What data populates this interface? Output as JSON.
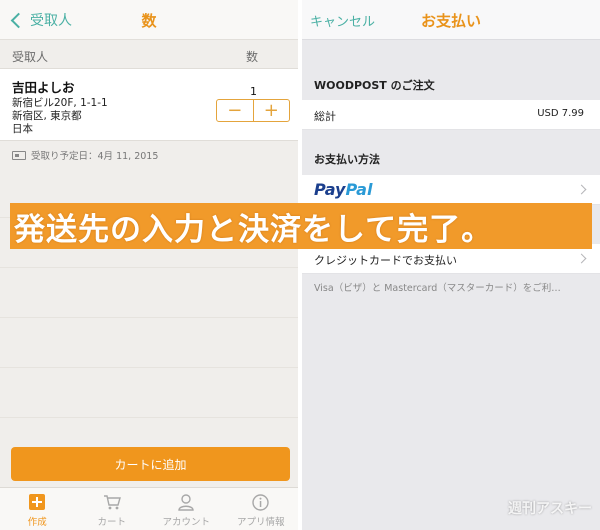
{
  "left": {
    "nav": {
      "back_label": "受取人",
      "title": "数"
    },
    "columns": {
      "recipient": "受取人",
      "quantity": "数"
    },
    "recipient": {
      "name": "吉田よしお",
      "address1": "新宿ビル20F, 1-1-1",
      "address2": "新宿区, 東京都",
      "country": "日本",
      "quantity": "1"
    },
    "stepper": {
      "minus": "−",
      "plus": "+"
    },
    "delivery": "受取り予定日：4月 11, 2015",
    "add_cart_label": "カートに追加",
    "tabs": [
      {
        "label": "作成",
        "icon": "plus-square-icon"
      },
      {
        "label": "カート",
        "icon": "cart-icon"
      },
      {
        "label": "アカウント",
        "icon": "person-icon"
      },
      {
        "label": "アプリ情報",
        "icon": "info-icon"
      }
    ]
  },
  "right": {
    "nav": {
      "cancel_label": "キャンセル",
      "title": "お支払い"
    },
    "order_section": "WOODPOST のご注文",
    "total_label": "総計",
    "total_value": "USD 7.99",
    "payment_section": "お支払い方法",
    "paypal": {
      "part1": "Pay",
      "part2": "Pal"
    },
    "credit_label": "クレジットカードでお支払い",
    "note": "Visa（ビザ）と Mastercard（マスターカード）をご利…"
  },
  "overlay_caption": "発送先の入力と決済をして完了。",
  "watermark": "週刊アスキー",
  "colors": {
    "accent": "#f0961d",
    "teal": "#4ab0a4",
    "paypal_dark": "#1b3f8d",
    "paypal_light": "#2a9ad6"
  }
}
